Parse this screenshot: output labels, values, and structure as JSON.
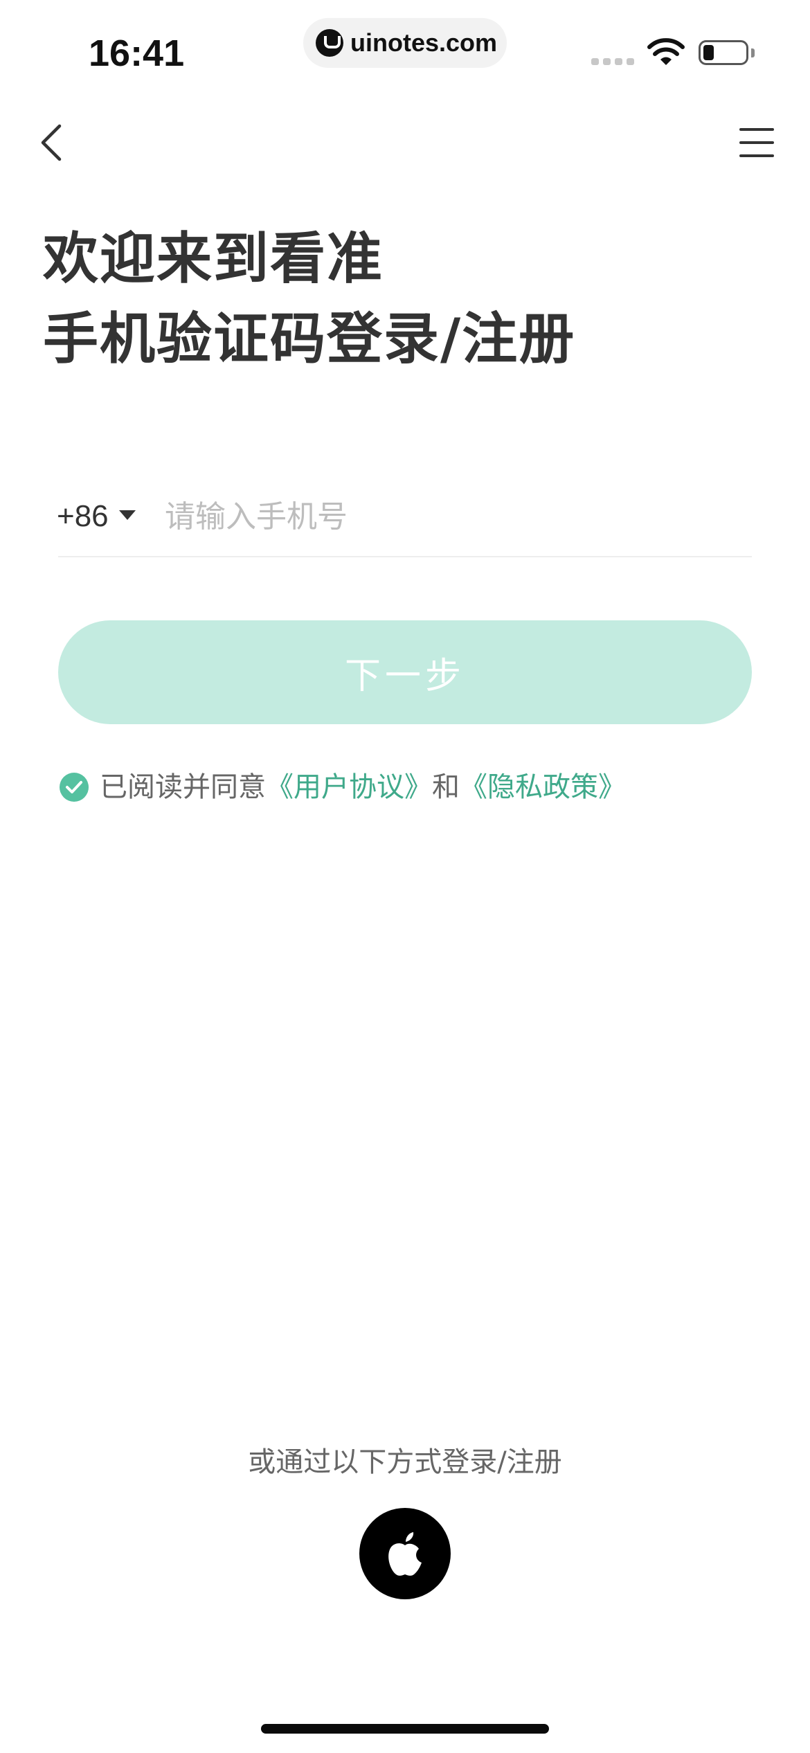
{
  "status_bar": {
    "time": "16:41",
    "url": "uinotes.com",
    "icons": [
      "cellular-signal-icon",
      "wifi-icon",
      "battery-icon"
    ]
  },
  "nav": {
    "back_icon": "chevron-left-icon",
    "menu_icon": "hamburger-menu-icon"
  },
  "header": {
    "title_line1": "欢迎来到看准",
    "title_line2": "手机验证码登录/注册"
  },
  "phone_form": {
    "country_code": "+86",
    "country_caret_icon": "caret-down-icon",
    "phone_placeholder": "请输入手机号",
    "phone_value": ""
  },
  "next_button": {
    "label": "下一步",
    "enabled": false,
    "color": "#c3ebe0"
  },
  "agreement": {
    "checked": true,
    "prefix": "已阅读并同意",
    "user_agreement": "《用户协议》",
    "conjunction": "和",
    "privacy_policy": "《隐私政策》",
    "accent_color": "#3fa98a",
    "check_color": "#55c1a0"
  },
  "alt_login": {
    "label": "或通过以下方式登录/注册",
    "providers": [
      "apple-logo-icon"
    ]
  }
}
